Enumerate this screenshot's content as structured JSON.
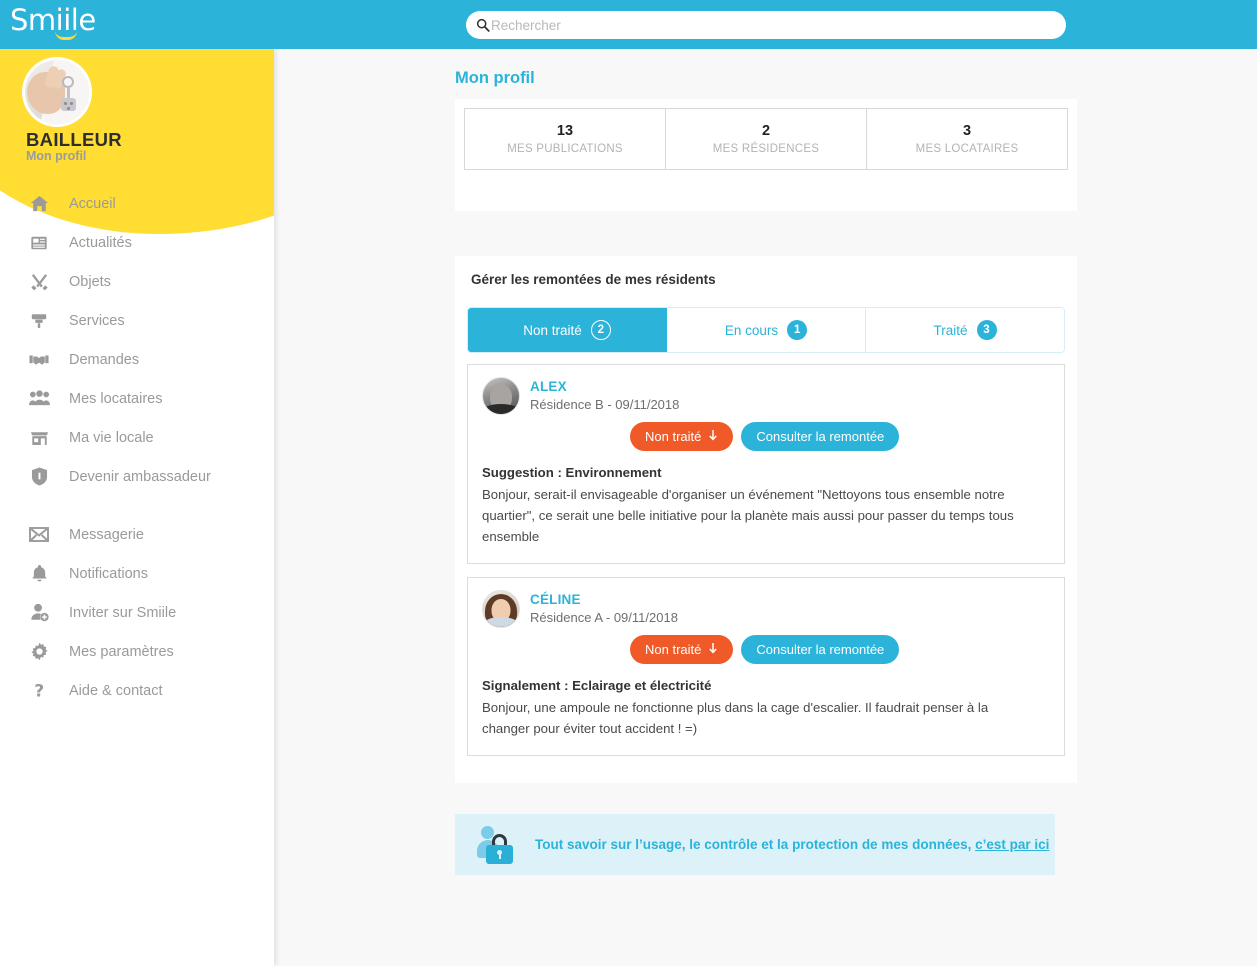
{
  "brand": {
    "name": "Smiile",
    "accent": "#2bb3d9",
    "yellow": "#ffdd33",
    "orange": "#f05a28"
  },
  "search": {
    "placeholder": "Rechercher",
    "value": ""
  },
  "profile": {
    "name": "BAILLEUR",
    "subtitle": "Mon profil"
  },
  "sidebar": {
    "items": [
      {
        "label": "Accueil",
        "icon": "home-icon"
      },
      {
        "label": "Actualités",
        "icon": "news-icon"
      },
      {
        "label": "Objets",
        "icon": "tools-icon"
      },
      {
        "label": "Services",
        "icon": "brush-icon"
      },
      {
        "label": "Demandes",
        "icon": "handshake-icon"
      },
      {
        "label": "Mes locataires",
        "icon": "users-icon"
      },
      {
        "label": "Ma vie locale",
        "icon": "shop-icon"
      },
      {
        "label": "Devenir ambassadeur",
        "icon": "shield-icon"
      }
    ],
    "items2": [
      {
        "label": "Messagerie",
        "icon": "envelope-icon"
      },
      {
        "label": "Notifications",
        "icon": "bell-icon"
      },
      {
        "label": "Inviter sur Smiile",
        "icon": "user-add-icon"
      },
      {
        "label": "Mes paramètres",
        "icon": "gear-icon"
      },
      {
        "label": "Aide & contact",
        "icon": "question-icon"
      }
    ]
  },
  "main": {
    "page_title": "Mon profil",
    "stats": [
      {
        "value": "13",
        "label": "MES PUBLICATIONS"
      },
      {
        "value": "2",
        "label": "MES RÉSIDENCES"
      },
      {
        "value": "3",
        "label": "MES LOCATAIRES"
      }
    ],
    "remontees": {
      "title": "Gérer les remontées de mes résidents",
      "tabs": [
        {
          "label": "Non traité",
          "count": "2",
          "active": true
        },
        {
          "label": "En cours",
          "count": "1",
          "active": false
        },
        {
          "label": "Traité",
          "count": "3",
          "active": false
        }
      ],
      "cards": [
        {
          "name": "ALEX",
          "meta": "Résidence B - 09/11/2018",
          "status_label": "Non traité",
          "consult_label": "Consulter la remontée",
          "subject": "Suggestion : Environnement",
          "body": "Bonjour, serait-il envisageable d'organiser un événement \"Nettoyons tous ensemble notre quartier\", ce serait une belle initiative pour la planète mais aussi pour passer du temps tous ensemble"
        },
        {
          "name": "CÉLINE",
          "meta": "Résidence A - 09/11/2018",
          "status_label": "Non traité",
          "consult_label": "Consulter la remontée",
          "subject": "Signalement : Eclairage et électricité",
          "body": "Bonjour, une ampoule ne fonctionne plus dans la cage d'escalier. Il faudrait penser à la changer pour éviter tout accident ! =)"
        }
      ]
    },
    "privacy": {
      "text": "Tout savoir sur l’usage, le contrôle et la protection de mes données,",
      "link": "c’est par ici"
    }
  }
}
